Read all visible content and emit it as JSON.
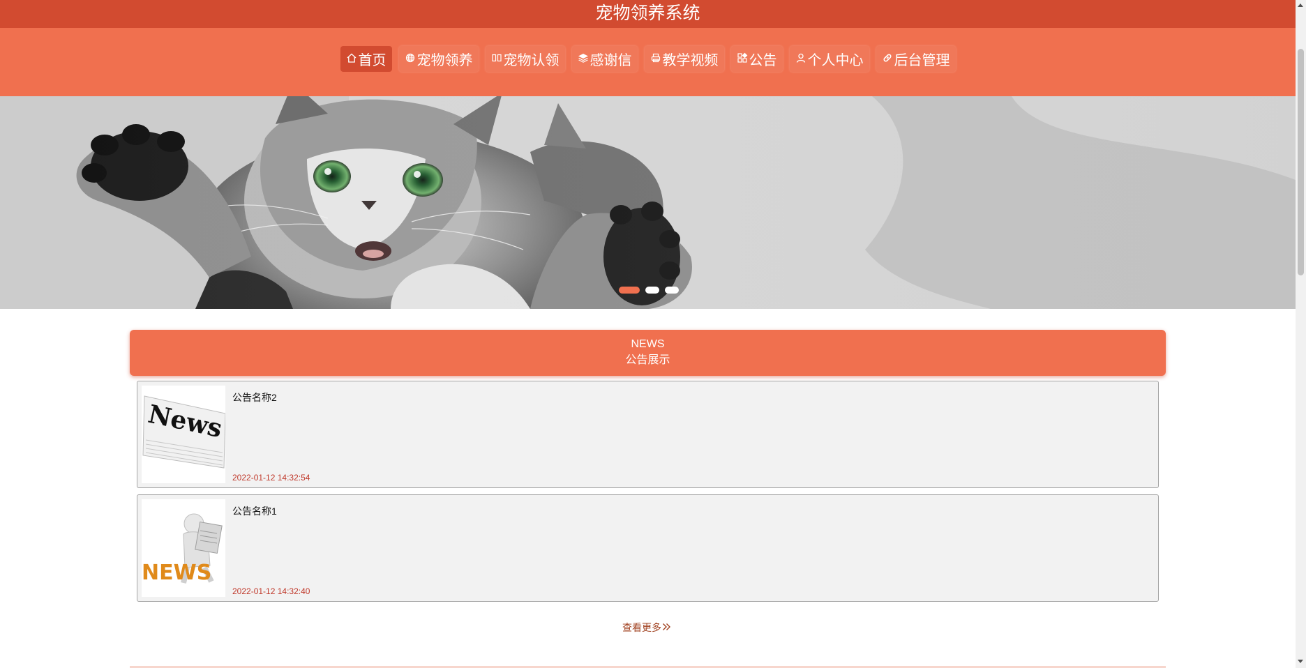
{
  "header": {
    "title": "宠物领养系统"
  },
  "nav": {
    "items": [
      {
        "label": "首页",
        "icon": "home-icon",
        "active": true
      },
      {
        "label": "宠物领养",
        "icon": "globe-icon",
        "active": false
      },
      {
        "label": "宠物认领",
        "icon": "tag-icon",
        "active": false
      },
      {
        "label": "感谢信",
        "icon": "layers-icon",
        "active": false
      },
      {
        "label": "教学视频",
        "icon": "printer-icon",
        "active": false
      },
      {
        "label": "公告",
        "icon": "apps-icon",
        "active": false
      },
      {
        "label": "个人中心",
        "icon": "user-icon",
        "active": false
      },
      {
        "label": "后台管理",
        "icon": "link-icon",
        "active": false
      }
    ]
  },
  "banner": {
    "slide_count": 3,
    "active_slide": 1
  },
  "news": {
    "title_en": "NEWS",
    "title_cn": "公告展示",
    "items": [
      {
        "name": "公告名称2",
        "date": "2022-01-12 14:32:54",
        "image": "news-newspaper-image"
      },
      {
        "name": "公告名称1",
        "date": "2022-01-12 14:32:40",
        "image": "news-figure-image"
      }
    ],
    "more_label": "查看更多"
  },
  "colors": {
    "primary": "#f0704f",
    "dark": "#d24b30",
    "date": "#c0392b"
  }
}
